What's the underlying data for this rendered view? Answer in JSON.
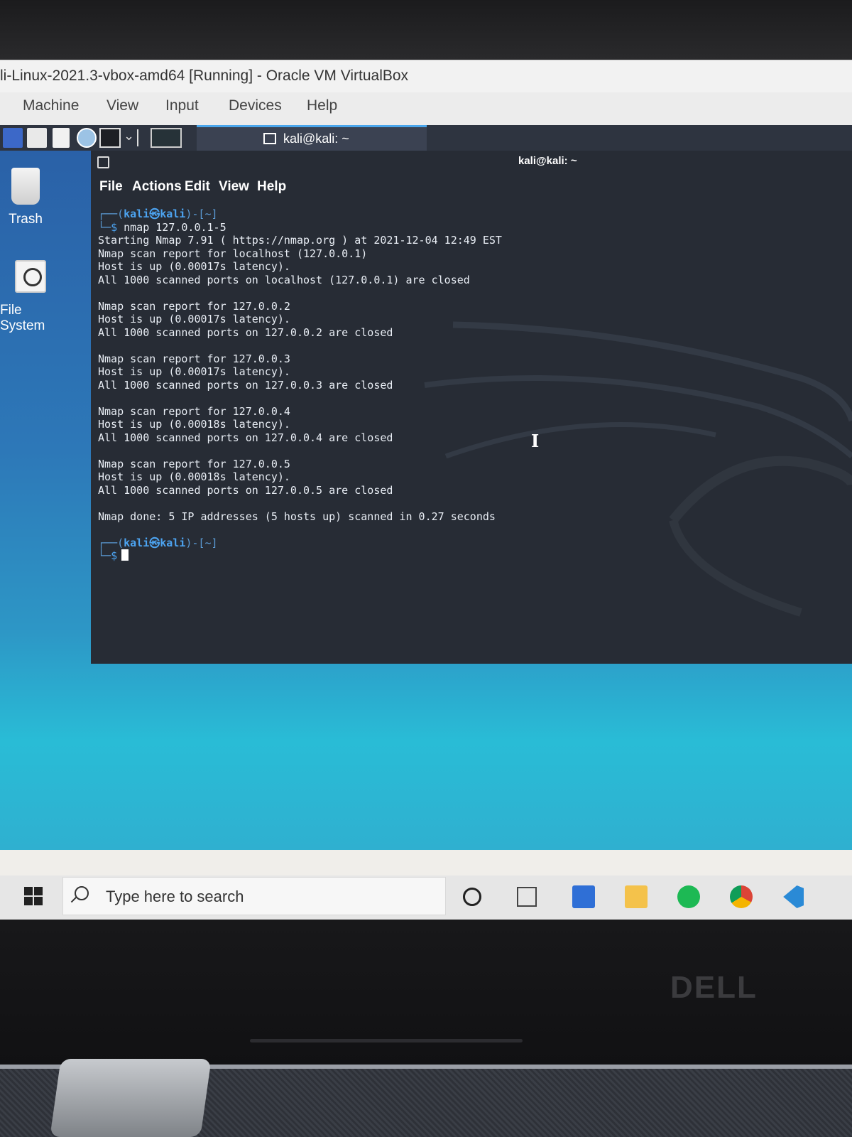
{
  "vbox": {
    "title": "li-Linux-2021.3-vbox-amd64 [Running] - Oracle VM VirtualBox",
    "menu": [
      "Machine",
      "View",
      "Input",
      "Devices",
      "Help"
    ]
  },
  "kali_panel": {
    "task_label": "kali@kali: ~"
  },
  "desktop": {
    "icons": [
      "Trash",
      "File System"
    ]
  },
  "terminal": {
    "window_title": "kali@kali: ~",
    "menu": [
      "File",
      "Actions",
      "Edit",
      "View",
      "Help"
    ],
    "prompt_user": "kali㉿kali",
    "prompt_dir": "-[~]",
    "command": "nmap 127.0.0.1-5",
    "output": [
      "Starting Nmap 7.91 ( https://nmap.org ) at 2021-12-04 12:49 EST",
      "Nmap scan report for localhost (127.0.0.1)",
      "Host is up (0.00017s latency).",
      "All 1000 scanned ports on localhost (127.0.0.1) are closed",
      "",
      "Nmap scan report for 127.0.0.2",
      "Host is up (0.00017s latency).",
      "All 1000 scanned ports on 127.0.0.2 are closed",
      "",
      "Nmap scan report for 127.0.0.3",
      "Host is up (0.00017s latency).",
      "All 1000 scanned ports on 127.0.0.3 are closed",
      "",
      "Nmap scan report for 127.0.0.4",
      "Host is up (0.00018s latency).",
      "All 1000 scanned ports on 127.0.0.4 are closed",
      "",
      "Nmap scan report for 127.0.0.5",
      "Host is up (0.00018s latency).",
      "All 1000 scanned ports on 127.0.0.5 are closed",
      "",
      "Nmap done: 5 IP addresses (5 hosts up) scanned in 0.27 seconds"
    ],
    "colors": {
      "background": "#272c35",
      "prompt": "#4ca3f0",
      "text": "#e9eef5"
    }
  },
  "windows_taskbar": {
    "search_placeholder": "Type here to search",
    "icons": [
      "windows-start-icon",
      "search-icon",
      "cortana-icon",
      "task-view-icon",
      "microsoft-store-icon",
      "file-explorer-icon",
      "spotify-icon",
      "chrome-icon",
      "vscode-icon"
    ]
  },
  "laptop": {
    "brand": "DELL"
  }
}
